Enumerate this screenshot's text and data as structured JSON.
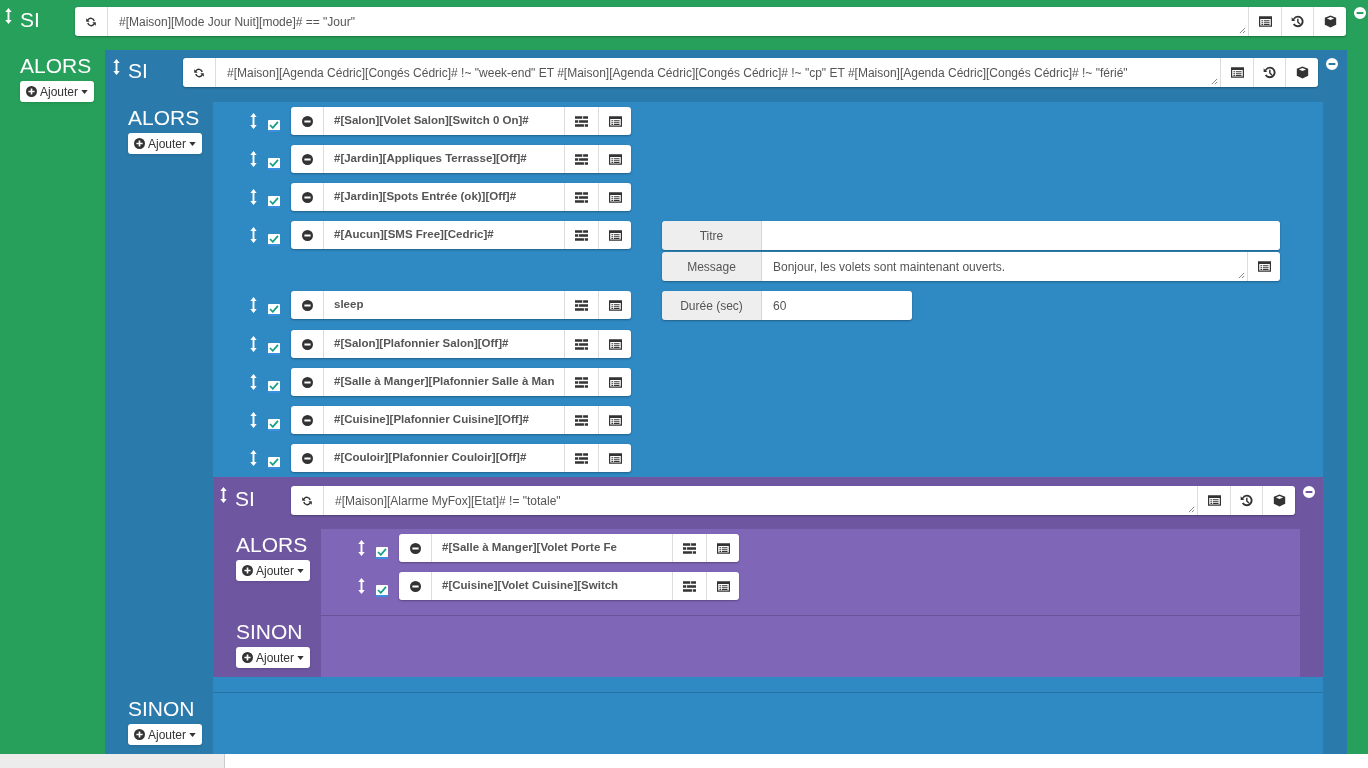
{
  "block": {
    "keyword": "SI",
    "condition": "#[Maison][Mode Jour Nuit][mode]# == \"Jour\"",
    "then_keyword": "ALORS",
    "then_add": "Ajouter",
    "items": [
      {
        "kind": "block",
        "keyword": "SI",
        "condition": "#[Maison][Agenda Cédric][Congés Cédric]# !~ \"week-end\" ET #[Maison][Agenda Cédric][Congés Cédric]# !~ \"cp\" ET #[Maison][Agenda Cédric][Congés Cédric]# !~ \"férié\"",
        "then_keyword": "ALORS",
        "then_add": "Ajouter",
        "items": [
          {
            "kind": "action",
            "enabled": true,
            "command": "#[Salon][Volet Salon][Switch 0 On]#"
          },
          {
            "kind": "action",
            "enabled": true,
            "command": "#[Jardin][Appliques Terrasse][Off]#"
          },
          {
            "kind": "action",
            "enabled": true,
            "command": "#[Jardin][Spots Entrée (ok)][Off]#"
          },
          {
            "kind": "action",
            "enabled": true,
            "command": "#[Aucun][SMS Free][Cedric]#",
            "options": [
              {
                "kind": "text",
                "label": "Titre"
              },
              {
                "kind": "textarea",
                "label": "Message",
                "value": "Bonjour, les volets sont maintenant ouverts."
              }
            ]
          },
          {
            "kind": "action",
            "enabled": true,
            "command": "sleep",
            "options": [
              {
                "kind": "number",
                "label": "Durée (sec)",
                "value": "60"
              }
            ]
          },
          {
            "kind": "action",
            "enabled": true,
            "command": "#[Salon][Plafonnier Salon][Off]#"
          },
          {
            "kind": "action",
            "enabled": true,
            "command": "#[Salle à Manger][Plafonnier Salle à Man"
          },
          {
            "kind": "action",
            "enabled": true,
            "command": "#[Cuisine][Plafonnier Cuisine][Off]#"
          },
          {
            "kind": "action",
            "enabled": true,
            "command": "#[Couloir][Plafonnier Couloir][Off]#"
          },
          {
            "kind": "block",
            "keyword": "SI",
            "condition": "#[Maison][Alarme MyFox][Etat]# != \"totale\"",
            "then_keyword": "ALORS",
            "then_add": "Ajouter",
            "items": [
              {
                "kind": "action",
                "enabled": true,
                "command": "#[Salle à Manger][Volet Porte Fe"
              },
              {
                "kind": "action",
                "enabled": true,
                "command": "#[Cuisine][Volet Cuisine][Switch"
              }
            ],
            "else_keyword": "SINON",
            "else_add": "Ajouter"
          }
        ],
        "else_keyword": "SINON",
        "else_add": "Ajouter"
      }
    ]
  }
}
